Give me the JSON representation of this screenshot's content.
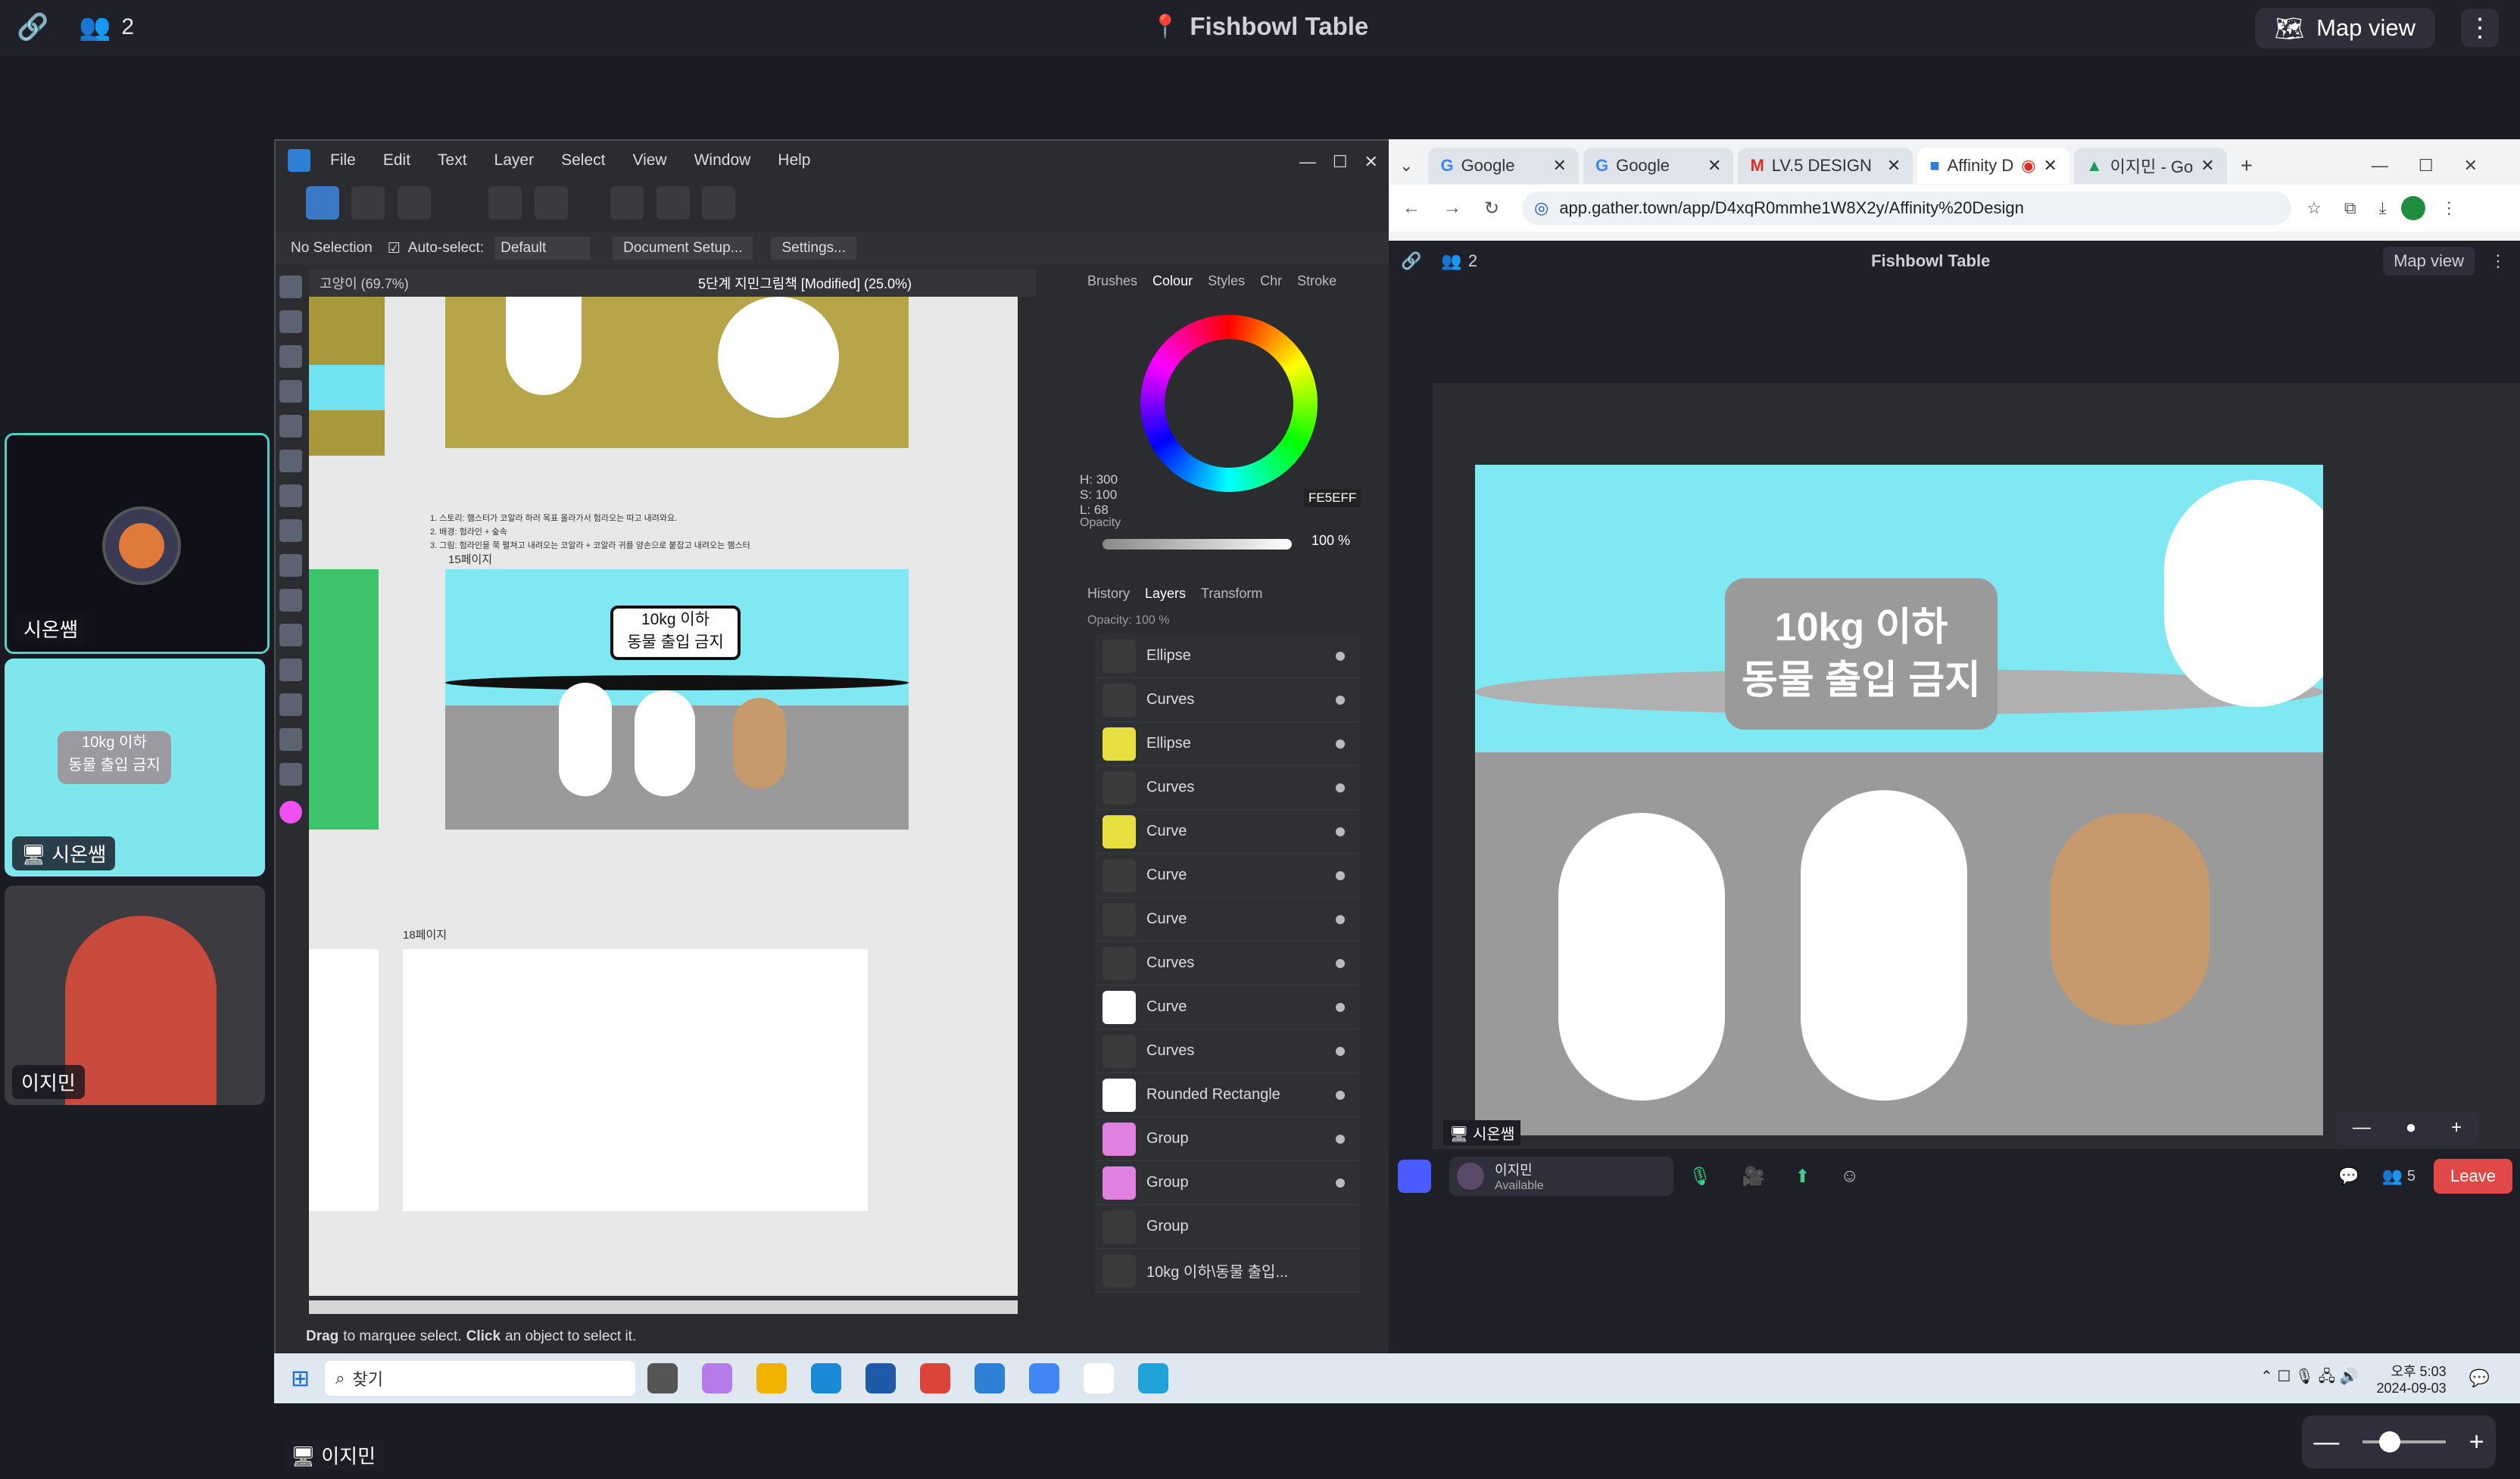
{
  "gather_top": {
    "participants": "2",
    "room": "Fishbowl Table",
    "map_view": "Map view"
  },
  "participants": [
    {
      "name": "시온쌤",
      "avatar_note": "avatar"
    },
    {
      "name": "시온쌤",
      "label": "screen share"
    },
    {
      "name": "이지민"
    }
  ],
  "affinity": {
    "menu": [
      "File",
      "Edit",
      "Text",
      "Layer",
      "Select",
      "View",
      "Window",
      "Help"
    ],
    "context": {
      "selection": "No Selection",
      "autoselect": "Auto-select:",
      "mode": "Default",
      "doc_setup": "Document Setup...",
      "settings": "Settings..."
    },
    "doc_tabs": [
      "고양이 (69.7%)",
      "5단계 지민그림책 [Modified] (25.0%)"
    ],
    "canvas": {
      "page15": "15페이지",
      "page18": "18페이지",
      "sign_line1": "10kg 이하",
      "sign_line2": "동물 출입 금지",
      "note1": "1. 스토리: 햄스터가 코알라 하러 목표 올라가서 험라오는 따고 내려와요.",
      "note2": "2. 배경: 험라인 + 숲속",
      "note3": "3. 그림: 험라인을 쭉 펼쳐고 내려오는 코알라 + 코알라 귀를 양손으로 붙잡고 내려오는 햄스터"
    },
    "colour_panel": {
      "tabs": [
        "Brushes",
        "Colour",
        "Styles",
        "Chr",
        "Stroke"
      ],
      "h": "H: 300",
      "s": "S: 100",
      "l": "L: 68",
      "hex": "FE5EFF",
      "opacity_label": "Opacity",
      "opacity_value": "100 %"
    },
    "layers_panel": {
      "tabs": [
        "History",
        "Layers",
        "Transform"
      ],
      "opacity": "Opacity: 100 %"
    },
    "layers": [
      "Ellipse",
      "Curves",
      "Ellipse",
      "Curves",
      "Curve",
      "Curve",
      "Curve",
      "Curves",
      "Curve",
      "Curves",
      "Rounded Rectangle",
      "Group",
      "Group",
      "Group",
      "10kg 이하\\동물 출입..."
    ],
    "status": {
      "drag": "Drag",
      "t1": "to marquee select.",
      "click": "Click",
      "t2": "an object to select it."
    }
  },
  "chrome": {
    "tabs": [
      "Google",
      "Google",
      "LV.5 DESIGN",
      "Affinity D",
      "이지민 - Go"
    ],
    "url": "app.gather.town/app/D4xqR0mmhe1W8X2y/Affinity%20Design",
    "inner": {
      "participants": "2",
      "room": "Fishbowl Table",
      "map_view": "Map view",
      "sign_line1": "10kg 이하",
      "sign_line2": "동물 출입 금지",
      "presenter": "시온쌤",
      "user_name": "이지민",
      "user_status": "Available",
      "count": "5",
      "leave": "Leave"
    }
  },
  "taskbar": {
    "search": "찾기",
    "time": "오후 5:03",
    "date": "2024-09-03"
  },
  "bottom_chip": "이지민"
}
